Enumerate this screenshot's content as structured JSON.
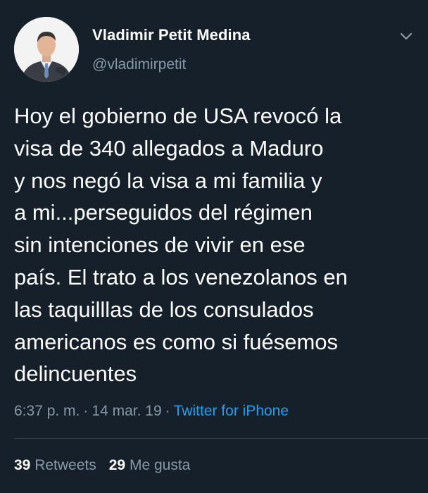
{
  "user": {
    "display_name": "Vladimir Petit Medina",
    "handle": "@vladimirpetit"
  },
  "tweet": {
    "lines": [
      "Hoy el gobierno de USA revocó la",
      "visa de 340 allegados a Maduro",
      "y nos negó la visa a mi familia y",
      "a mi...perseguidos del régimen",
      "sin intenciones de vivir en ese",
      "país. El trato a los venezolanos en",
      "las taquilllas de los consulados",
      "americanos es como si fuésemos",
      "delincuentes"
    ],
    "time": "6:37 p. m.",
    "separator": "·",
    "date": "14 mar. 19",
    "source": "Twitter for iPhone"
  },
  "stats": {
    "retweets_count": "39",
    "retweets_label": "Retweets",
    "likes_count": "29",
    "likes_label": "Me gusta"
  },
  "icons": {
    "menu": "chevron-down-icon"
  },
  "colors": {
    "background": "#15202b",
    "text": "#ffffff",
    "secondary": "#8899a6",
    "link": "#1da1f2",
    "divider": "#38444d"
  }
}
